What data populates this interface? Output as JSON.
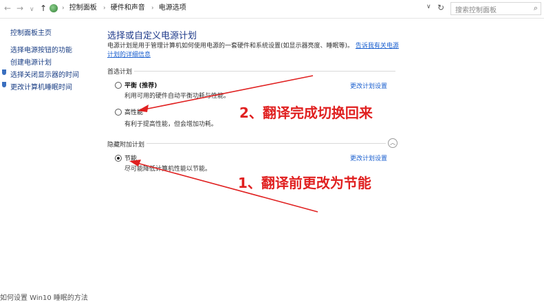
{
  "nav": {
    "back": "←",
    "forward": "→",
    "recent": "∨",
    "up": "↑"
  },
  "breadcrumb": [
    "控制面板",
    "硬件和声音",
    "电源选项"
  ],
  "search": {
    "placeholder": "搜索控制面板"
  },
  "sidebar": {
    "home": "控制面板主页",
    "items": [
      "选择电源按钮的功能",
      "创建电源计划",
      "选择关闭显示器的时间",
      "更改计算机睡眠时间"
    ]
  },
  "main": {
    "title": "选择或自定义电源计划",
    "description": "电源计划是用于管理计算机如何使用电源的一套硬件和系统设置(如显示器亮度、睡眠等)。",
    "link": "告诉我有关电源计划的详细信息",
    "preferred_label": "首选计划",
    "hidden_label": "隐藏附加计划",
    "change_label": "更改计划设置",
    "plans": [
      {
        "name": "平衡 (推荐)",
        "desc": "利用可用的硬件自动平衡功耗与性能。",
        "selected": false
      },
      {
        "name": "高性能",
        "desc": "有利于提高性能，但会增加功耗。",
        "selected": false
      },
      {
        "name": "节能",
        "desc": "尽可能降低计算机性能以节能。",
        "selected": true
      }
    ]
  },
  "annotations": {
    "top": "2、翻译完成切换回来",
    "bottom": "1、翻译前更改为节能"
  },
  "bottom_partial": "如何设置 Win10 睡眠的方法",
  "colors": {
    "annotation": "#e02020",
    "link": "#1a5fcf",
    "title": "#1e3a8a"
  }
}
